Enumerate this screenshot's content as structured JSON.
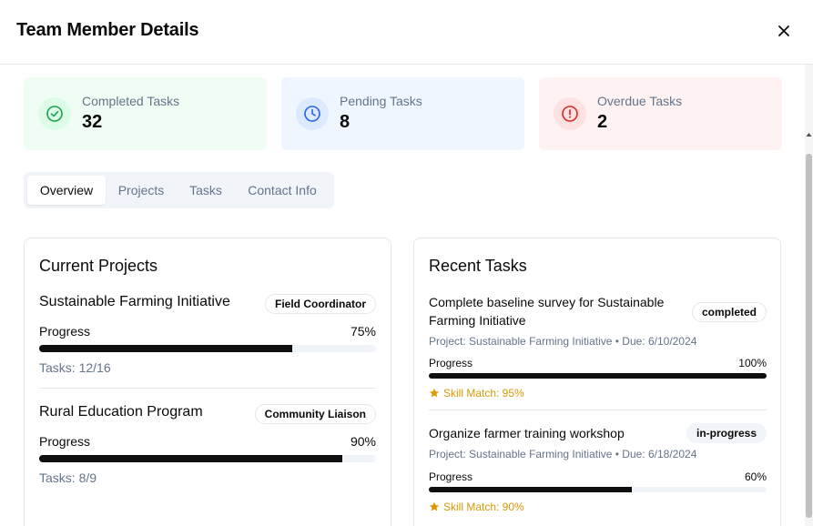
{
  "modal": {
    "title": "Team Member Details"
  },
  "stats": [
    {
      "label": "Completed Tasks",
      "value": "32",
      "icon": "check-circle-icon",
      "color": "#16a34a"
    },
    {
      "label": "Pending Tasks",
      "value": "8",
      "icon": "clock-icon",
      "color": "#2563eb"
    },
    {
      "label": "Overdue Tasks",
      "value": "2",
      "icon": "alert-circle-icon",
      "color": "#dc2626"
    }
  ],
  "tabs": [
    {
      "label": "Overview",
      "active": true
    },
    {
      "label": "Projects",
      "active": false
    },
    {
      "label": "Tasks",
      "active": false
    },
    {
      "label": "Contact Info",
      "active": false
    }
  ],
  "current_projects": {
    "title": "Current Projects",
    "items": [
      {
        "name": "Sustainable Farming Initiative",
        "role": "Field Coordinator",
        "progress_label": "Progress",
        "progress": "75%",
        "progress_value": 0.75,
        "tasks": "Tasks: 12/16"
      },
      {
        "name": "Rural Education Program",
        "role": "Community Liaison",
        "progress_label": "Progress",
        "progress": "90%",
        "progress_value": 0.9,
        "tasks": "Tasks: 8/9"
      }
    ]
  },
  "recent_tasks": {
    "title": "Recent Tasks",
    "items": [
      {
        "title": "Complete baseline survey for Sustainable Farming Initiative",
        "status": "completed",
        "meta": "Project: Sustainable Farming Initiative • Due: 6/10/2024",
        "progress_label": "Progress",
        "progress": "100%",
        "progress_value": 1.0,
        "skill": "Skill Match: 95%"
      },
      {
        "title": "Organize farmer training workshop",
        "status": "in-progress",
        "meta": "Project: Sustainable Farming Initiative • Due: 6/18/2024",
        "progress_label": "Progress",
        "progress": "60%",
        "progress_value": 0.6,
        "skill": "Skill Match: 90%"
      }
    ]
  },
  "colors": {
    "skill": "#d99a06",
    "progress_fill": "#0f0f0f"
  }
}
